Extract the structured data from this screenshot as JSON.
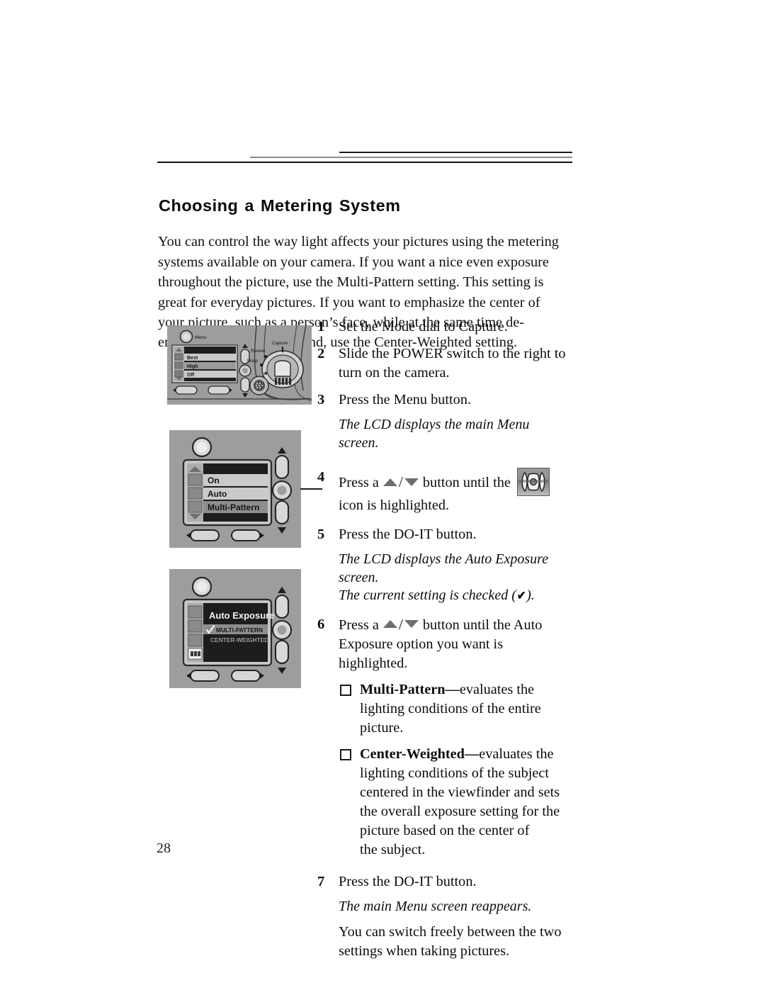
{
  "document": {
    "page_number": "28",
    "heading": "Choosing a Metering System",
    "intro": "You can control the way light affects your pictures using the metering systems available on your camera. If you want a nice even exposure throughout the picture, use the Multi-Pattern setting. This setting is great for everyday pictures. If you want to emphasize the center of your picture, such as a person’s face, while at the same time de-emphasizing the background, use the Center-Weighted setting."
  },
  "steps": {
    "s1": {
      "num": "1",
      "text": "Set the Mode dial to Capture."
    },
    "s2": {
      "num": "2",
      "text": "Slide the POWER switch to the right to turn on the camera."
    },
    "s3": {
      "num": "3",
      "text": "Press the Menu button.",
      "note": "The LCD displays the main Menu screen."
    },
    "s4": {
      "num": "4",
      "text_before": "Press a",
      "text_middle": "button until the",
      "text_after": "icon is highlighted."
    },
    "s5": {
      "num": "5",
      "text": "Press the DO-IT button.",
      "note_line1": "The LCD displays the Auto Exposure screen.",
      "note_line2_before": "The current setting is checked (",
      "note_check": "✔",
      "note_line2_after": ")."
    },
    "s6": {
      "num": "6",
      "text_before": "Press a",
      "text_after": "button until the Auto Exposure option you want is highlighted.",
      "bullets": [
        {
          "term": "Multi-Pattern",
          "dash": "—",
          "text": "evaluates the lighting conditions of the entire picture."
        },
        {
          "term": "Center-Weighted",
          "dash": "—",
          "text": "evaluates the lighting conditions of the subject centered in the viewfinder and sets the overall exposure setting for the picture based on the center of",
          "text_line2": "the subject."
        }
      ]
    },
    "s7": {
      "num": "7",
      "text": "Press the DO-IT button.",
      "note": "The main Menu screen reappears.",
      "closing": "You can switch freely between the two settings when taking pictures."
    }
  },
  "figures": {
    "camera_back": {
      "menu_button_label": "Menu",
      "dial_labels": {
        "capture": "Capture",
        "review": "Review",
        "setup": "Setup"
      },
      "lcd_rows": [
        "Best",
        "High",
        "Off"
      ]
    },
    "menu_screen": {
      "lcd_rows": [
        "On",
        "Auto",
        "Multi-Pattern"
      ],
      "highlighted_row": "Multi-Pattern"
    },
    "ae_screen": {
      "title": "Auto Exposure",
      "options": [
        "MULTI-PATTERN",
        "CENTER-WEIGHTED"
      ],
      "checked_option": "MULTI-PATTERN",
      "check_glyph": "✔"
    }
  },
  "colors": {
    "page_background": "#ffffff",
    "text": "#111111",
    "figure_body": "#9d9d9d",
    "lcd_dark": "#1c1c1c",
    "lcd_row": "#c9c9c9",
    "lcd_highlight": "#8e8e8e",
    "arrow_gray": "#6e6e6e"
  }
}
